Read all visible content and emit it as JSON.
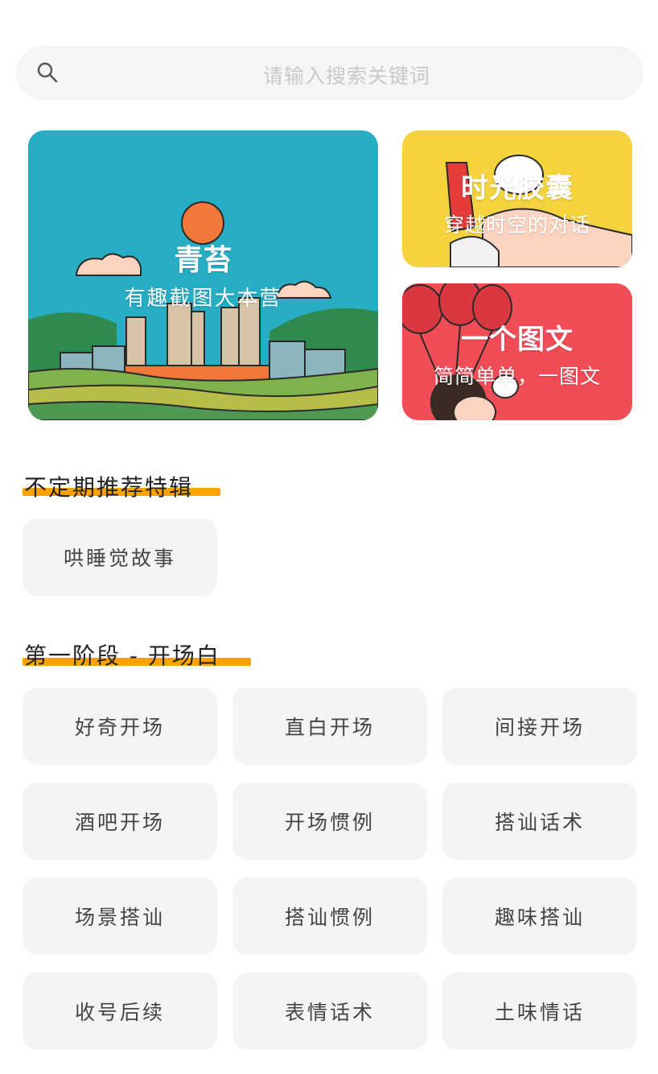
{
  "search": {
    "placeholder": "请输入搜索关键词",
    "icon": "search-icon"
  },
  "banners": {
    "main": {
      "title": "青苔",
      "subtitle": "有趣截图大本营"
    },
    "top_right": {
      "title": "时光胶囊",
      "subtitle": "穿越时空的对话"
    },
    "bottom_right": {
      "title": "一个图文",
      "subtitle": "简简单单，一图文"
    }
  },
  "sections": [
    {
      "title": "不定期推荐特辑",
      "items": [
        "哄睡觉故事"
      ]
    },
    {
      "title": "第一阶段 - 开场白",
      "items": [
        "好奇开场",
        "直白开场",
        "间接开场",
        "酒吧开场",
        "开场惯例",
        "搭讪话术",
        "场景搭讪",
        "搭讪惯例",
        "趣味搭讪",
        "收号后续",
        "表情话术",
        "土味情话"
      ]
    }
  ],
  "colors": {
    "accent": "#ffa200",
    "chip_bg": "#f4f4f5",
    "teal": "#27adc4",
    "yellow": "#f4d33f",
    "red": "#f14d57"
  }
}
